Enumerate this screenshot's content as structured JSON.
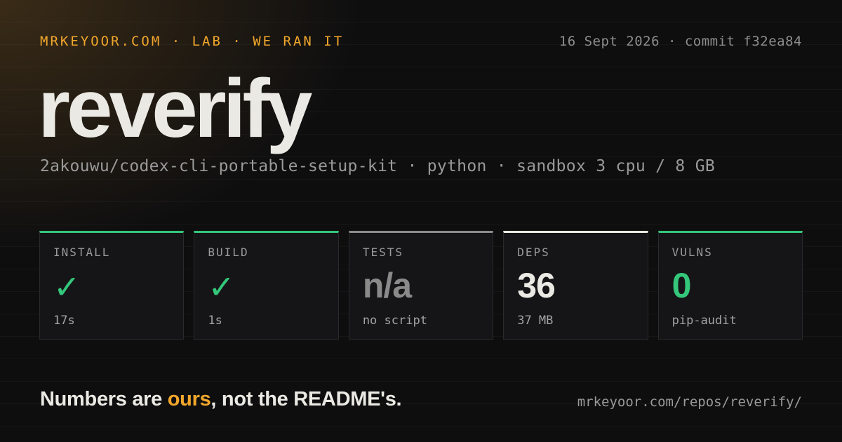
{
  "header": {
    "kicker": "MRKEYOOR.COM · LAB · WE RAN IT",
    "meta": "16 Sept 2026 · commit f32ea84"
  },
  "title": "reverify",
  "subtitle": "2akouwu/codex-cli-portable-setup-kit · python · sandbox 3 cpu / 8 GB",
  "cards": [
    {
      "label": "INSTALL",
      "value": "✓",
      "note": "17s",
      "status": "pass",
      "accent": "#34c77b"
    },
    {
      "label": "BUILD",
      "value": "✓",
      "note": "1s",
      "status": "pass",
      "accent": "#34c77b"
    },
    {
      "label": "TESTS",
      "value": "n/a",
      "note": "no script",
      "status": "neutral",
      "accent": "#8c8c8c"
    },
    {
      "label": "DEPS",
      "value": "36",
      "note": "37 MB",
      "status": "info",
      "accent": "#ebe9e3"
    },
    {
      "label": "VULNS",
      "value": "0",
      "note": "pip-audit",
      "status": "pass",
      "accent": "#34c77b"
    }
  ],
  "tagline": {
    "before": "Numbers are ",
    "highlight": "ours",
    "after": ", not the README's."
  },
  "url": "mrkeyoor.com/repos/reverify/",
  "colors": {
    "accent_orange": "#f2a72b",
    "pass_green": "#34c77b",
    "background": "#0e0e0f"
  }
}
